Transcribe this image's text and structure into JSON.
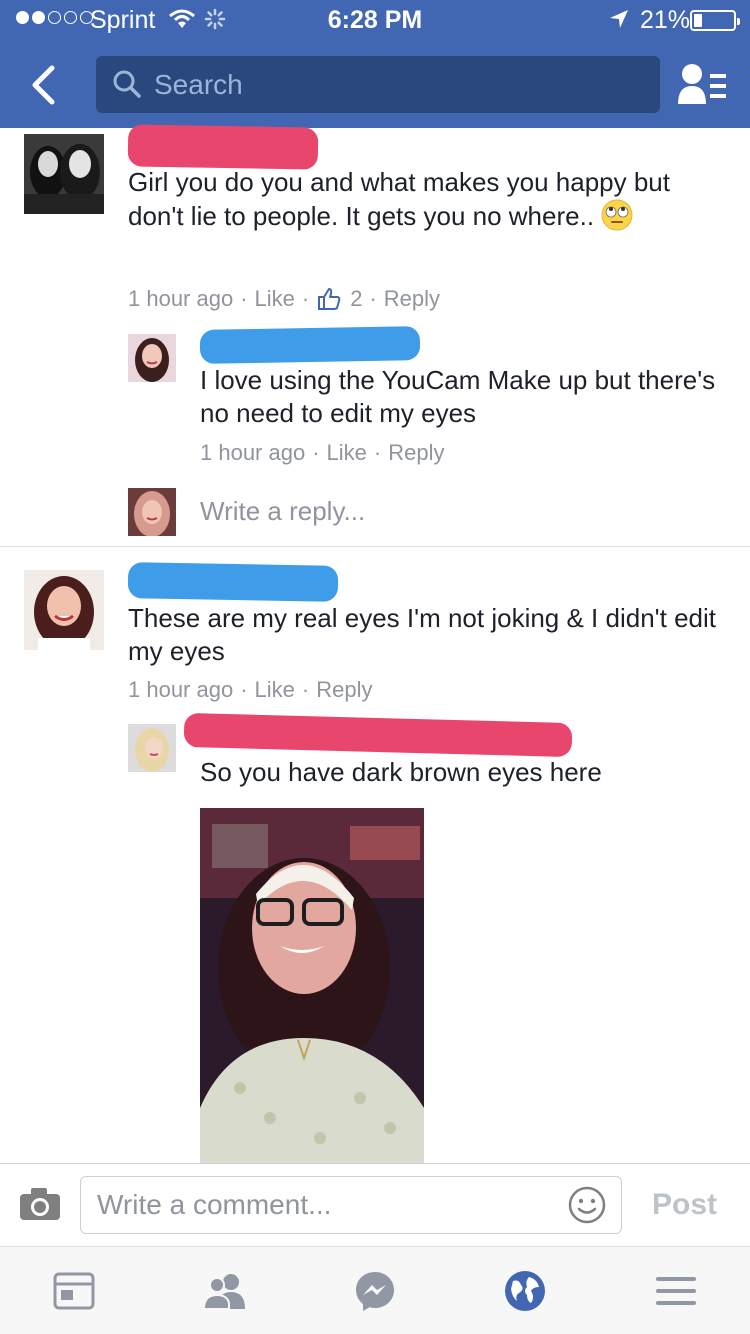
{
  "status_bar": {
    "carrier": "Sprint",
    "time": "6:28 PM",
    "battery": "21%",
    "battery_level": 0.21
  },
  "header": {
    "search_placeholder": "Search"
  },
  "comments": [
    {
      "text": "Girl you do you and what makes you happy but don't lie to people. It gets you no where..",
      "emoji": "eye-roll-emoji",
      "time": "1 hour ago",
      "like_label": "Like",
      "like_count": "2",
      "reply_label": "Reply",
      "replies": [
        {
          "text": "I love using the YouCam Make up but there's no need to edit my eyes",
          "time": "1 hour ago",
          "like_label": "Like",
          "reply_label": "Reply"
        }
      ],
      "write_reply_placeholder": "Write a reply..."
    },
    {
      "text": "These are my real eyes I'm not joking & I didn't edit my eyes",
      "time": "1 hour ago",
      "like_label": "Like",
      "reply_label": "Reply",
      "replies": [
        {
          "text": "So you have dark brown eyes here"
        }
      ]
    }
  ],
  "composer": {
    "placeholder": "Write a comment...",
    "post_label": "Post"
  },
  "tabs": [
    "news-feed-icon",
    "friend-requests-icon",
    "messenger-icon",
    "notifications-globe-icon",
    "more-menu-icon"
  ],
  "colors": {
    "brand": "#4267b2",
    "search_bg": "#29487d",
    "redaction_red": "#e8466d",
    "redaction_blue": "#3f9ce8",
    "meta_gray": "#90949c"
  }
}
